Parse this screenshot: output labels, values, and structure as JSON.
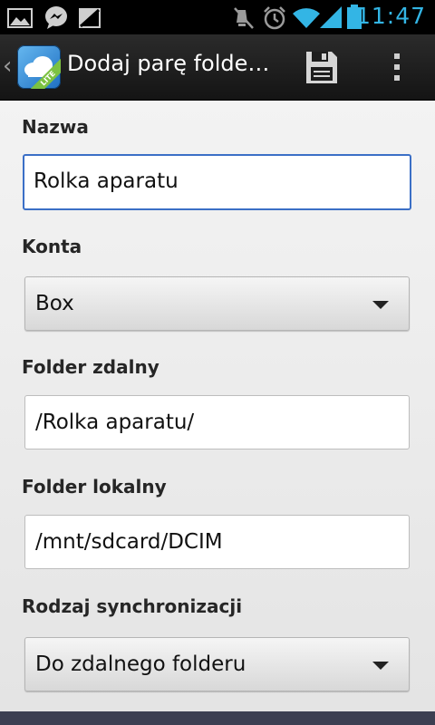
{
  "status_bar": {
    "time": "11:47",
    "icons": [
      "gallery-icon",
      "messenger-icon",
      "image-icon",
      "mute-icon",
      "alarm-icon",
      "wifi-icon",
      "signal-icon",
      "battery-icon"
    ]
  },
  "action_bar": {
    "title": "Dodaj parę folde…",
    "badge": "LITE",
    "actions": [
      "save-icon",
      "overflow-menu-icon"
    ]
  },
  "form": {
    "name_label": "Nazwa",
    "name_value": "Rolka aparatu",
    "account_label": "Konta",
    "account_value": "Box",
    "remote_label": "Folder zdalny",
    "remote_value": "/Rolka aparatu/",
    "local_label": "Folder lokalny",
    "local_value": "/mnt/sdcard/DCIM",
    "sync_label": "Rodzaj synchronizacji",
    "sync_value": "Do zdalnego folderu"
  },
  "colors": {
    "accent": "#33b5e5",
    "focus_border": "#3b6fc6",
    "action_bar": "#1e1e1e"
  }
}
